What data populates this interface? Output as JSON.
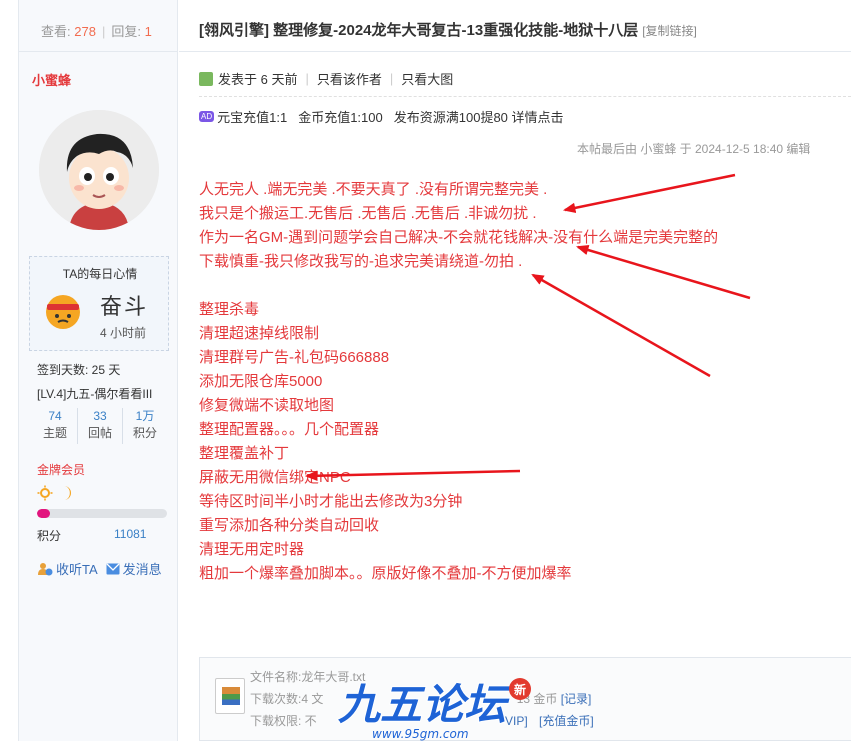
{
  "stats": {
    "views_label": "查看:",
    "views": "278",
    "replies_label": "回复:",
    "replies": "1"
  },
  "author": {
    "name": "小蜜蜂",
    "mood_title": "TA的每日心情",
    "mood": "奋斗",
    "mood_time": "4 小时前",
    "signin": "签到天数: 25 天",
    "level": "[LV.4]九五-偶尔看看III",
    "counts": [
      {
        "value": "74",
        "label": "主题"
      },
      {
        "value": "33",
        "label": "回帖"
      },
      {
        "value": "1万",
        "label": "积分"
      }
    ],
    "member": "金牌会员",
    "progress": 0.1,
    "credit_label": "积分",
    "credit_value": "11081",
    "follow": "收听TA",
    "message": "发消息"
  },
  "post": {
    "title": "[翎风引擎] 整理修复-2024龙年大哥复古-13重强化技能-地狱十八层",
    "copy_link": "[复制链接]",
    "posted": "发表于 6 天前",
    "only_author": "只看该作者",
    "only_image": "只看大图",
    "ad_tag": "AD",
    "ads": [
      "元宝充值1:1",
      "金币充值1:100",
      "发布资源满100提80 详情点击"
    ],
    "edited": "本帖最后由 小蜜蜂 于 2024-12-5 18:40 编辑",
    "lines": [
      "人无完人 .端无完美 .不要天真了 .没有所谓完整完美 .",
      "我只是个搬运工.无售后 .无售后 .无售后 .非诚勿扰 .",
      "作为一名GM-遇到问题学会自己解决-不会就花钱解决-没有什么端是完美完整的",
      "下载慎重-我只修改我写的-追求完美请绕道-勿拍 .",
      "",
      "整理杀毒",
      "清理超速掉线限制",
      "清理群号广告-礼包码666888",
      "添加无限仓库5000",
      "修复微端不读取地图",
      "整理配置器。。。几个配置器",
      "整理覆盖补丁",
      "屏蔽无用微信绑定NPC",
      "等待区时间半小时才能出去修改为3分钟",
      "重写添加各种分类自动回收",
      "清理无用定时器",
      "粗加一个爆率叠加脚本。。原版好像不叠加-不方便加爆率"
    ]
  },
  "attachment": {
    "name": "文件名称:龙年大哥.txt",
    "downloads": "下载次数:4  文",
    "cost_tail": "13 金币",
    "record": "[记录]",
    "permission": "下载权限: 不",
    "vip": "VIP]",
    "recharge": "[充值金币]"
  },
  "watermark": {
    "text": "九五论坛",
    "badge": "新",
    "url": "www.95gm.com"
  }
}
